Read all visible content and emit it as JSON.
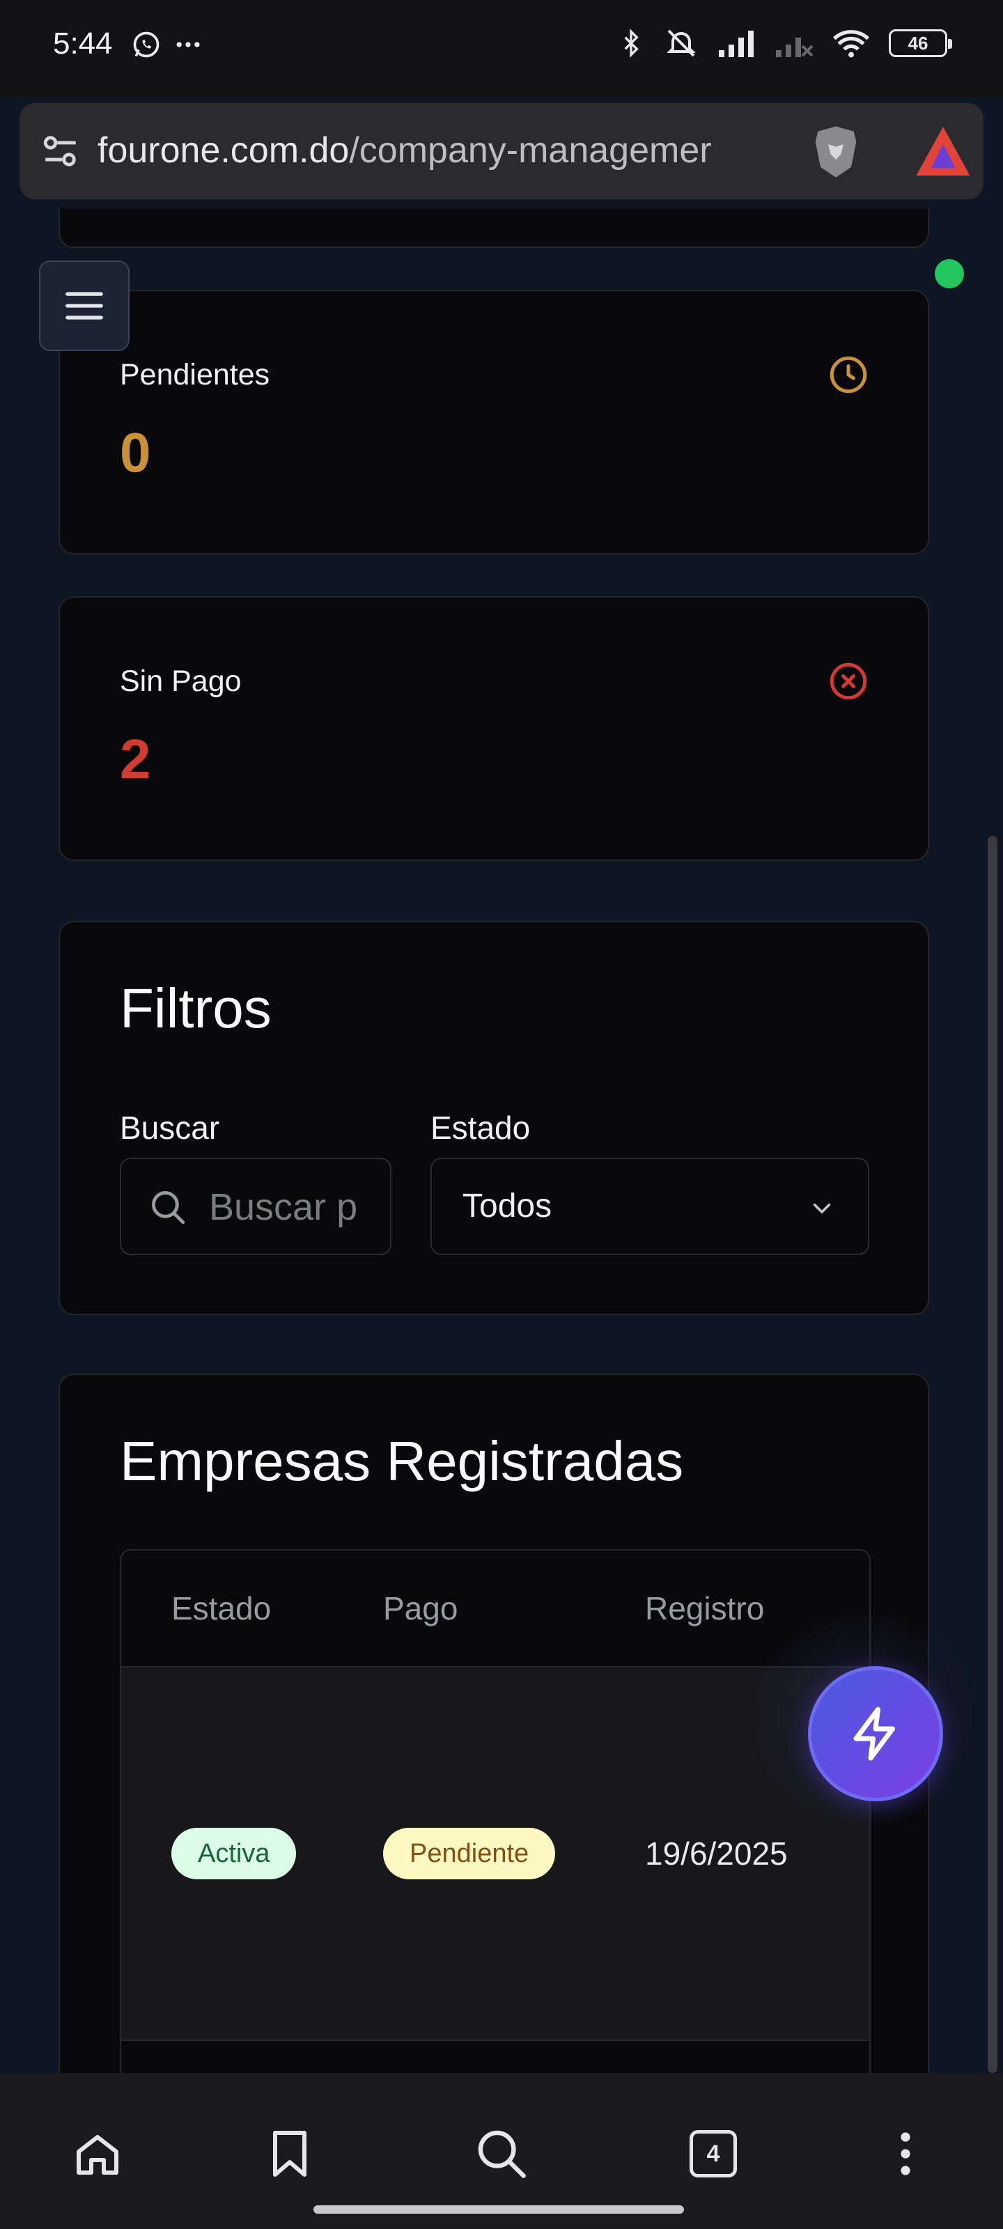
{
  "status_bar": {
    "time": "5:44",
    "battery": "46"
  },
  "browser": {
    "url_domain": "fourone.com.do",
    "url_path": "/company-managemer",
    "tab_count": "4"
  },
  "stats": [
    {
      "label": "Pendientes",
      "value": "0",
      "color": "#c9923a",
      "icon": "clock-icon"
    },
    {
      "label": "Sin Pago",
      "value": "2",
      "color": "#d13c32",
      "icon": "x-circle-icon"
    }
  ],
  "filters": {
    "title": "Filtros",
    "search_label": "Buscar",
    "search_placeholder": "Buscar p",
    "status_label": "Estado",
    "status_value": "Todos"
  },
  "companies": {
    "title": "Empresas Registradas",
    "columns": [
      "Estado",
      "Pago",
      "Registro"
    ],
    "rows": [
      {
        "estado": "Activa",
        "pago": "Pendiente",
        "registro": "19/6/2025"
      }
    ]
  },
  "colors": {
    "accent_green": "#22c55e",
    "fab_start": "#4b5be0",
    "fab_end": "#7b3fe4"
  }
}
